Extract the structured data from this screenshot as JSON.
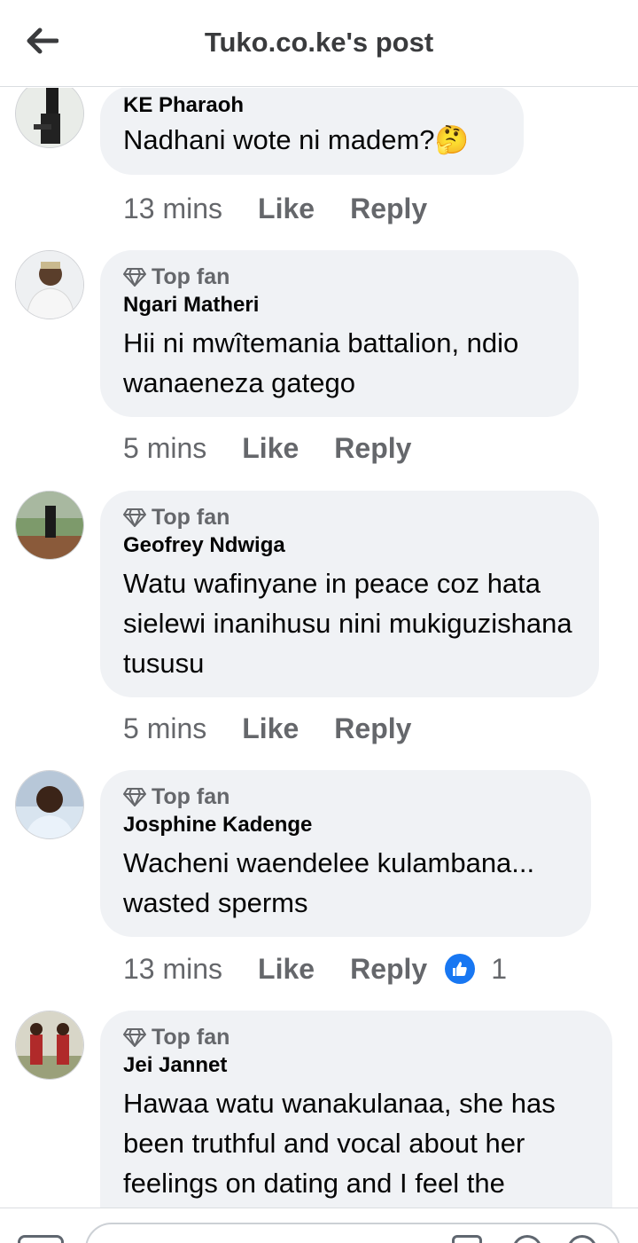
{
  "header": {
    "title": "Tuko.co.ke's post"
  },
  "comments": [
    {
      "author": "KE Pharaoh",
      "top_fan": "",
      "text": "Nadhani wote ni madem?",
      "emoji": "🤔",
      "time": "13 mins",
      "like": "Like",
      "reply": "Reply",
      "reactions": ""
    },
    {
      "author": "Ngari Matheri",
      "top_fan": "Top fan",
      "text": "Hii ni mwîtemania battalion, ndio wanaeneza gatego",
      "time": "5 mins",
      "like": "Like",
      "reply": "Reply",
      "reactions": ""
    },
    {
      "author": "Geofrey Ndwiga",
      "top_fan": "Top fan",
      "text": "Watu wafinyane in peace coz hata sielewi inanihusu nini mukiguzishana tususu",
      "time": "5 mins",
      "like": "Like",
      "reply": "Reply",
      "reactions": ""
    },
    {
      "author": "Josphine Kadenge",
      "top_fan": "Top fan",
      "text": "Wacheni waendelee kulambana... wasted sperms",
      "time": "13 mins",
      "like": "Like",
      "reply": "Reply",
      "reactions": "1"
    },
    {
      "author": "Jei Jannet",
      "top_fan": "Top fan",
      "text": "Hawaa watu wanakulanaa, she has been truthful and vocal about her feelings on dating and I feel the",
      "time": "",
      "like": "",
      "reply": "",
      "reactions": ""
    }
  ],
  "colors": {
    "bubble": "#f0f2f5",
    "meta": "#65676b",
    "like_reaction": "#1877f2"
  }
}
